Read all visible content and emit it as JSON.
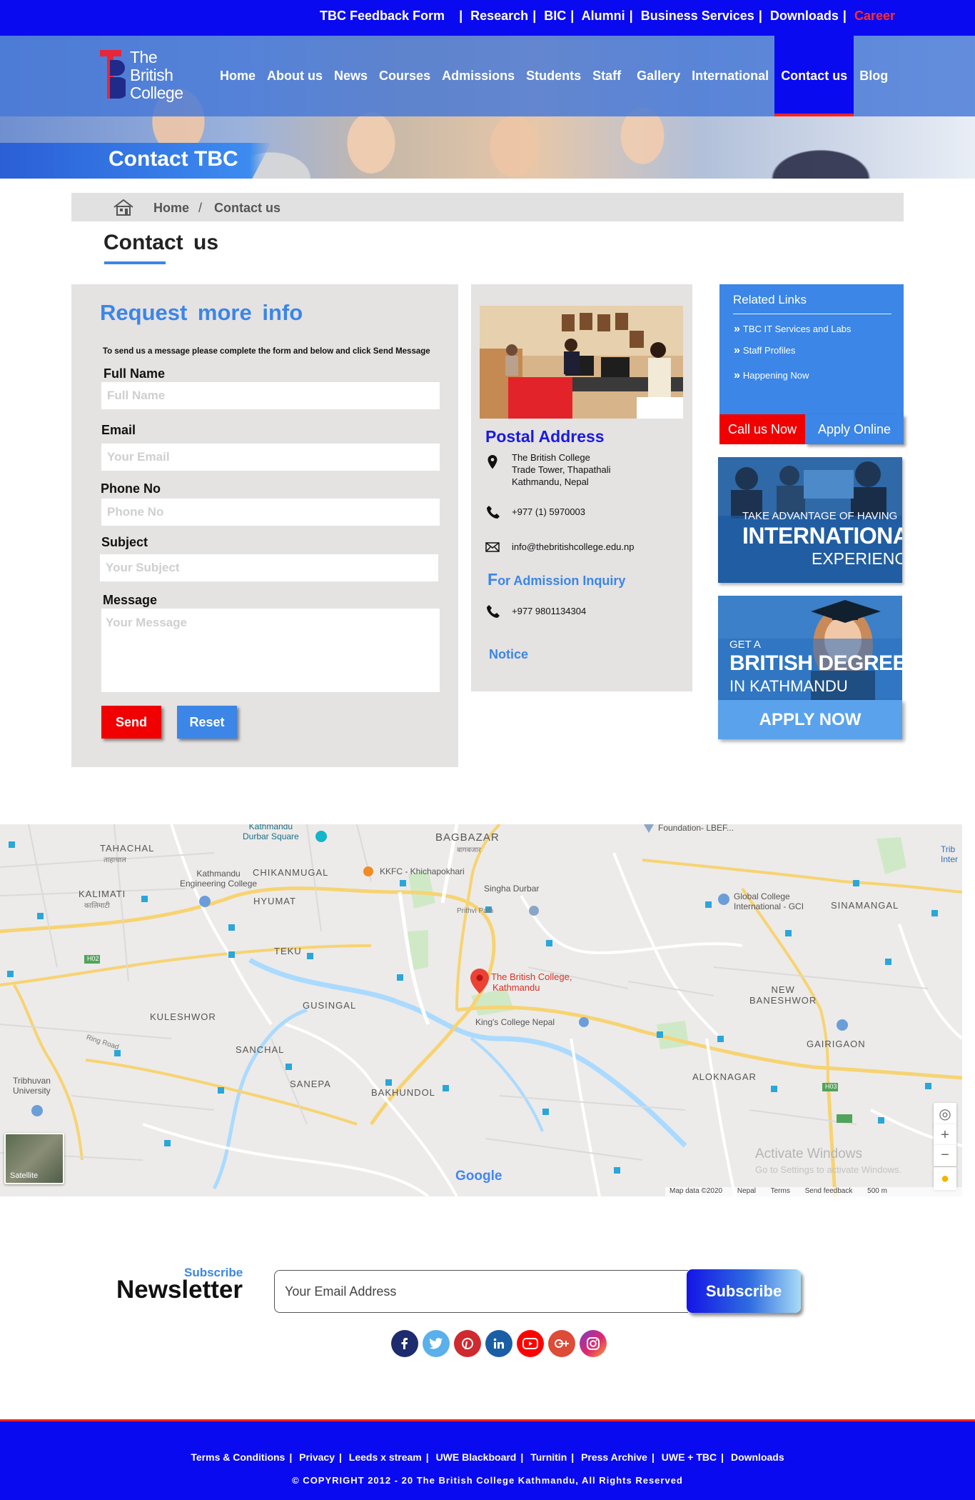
{
  "topbar": {
    "feedback": "TBC Feedback Form",
    "links": [
      "Research",
      "BIC",
      "Alumni",
      "Business Services",
      "Downloads"
    ],
    "career": "Career"
  },
  "logo": {
    "line1": "The",
    "line2": "British",
    "line3": "College"
  },
  "nav": [
    "Home",
    "About us",
    "News",
    "Courses",
    "Admissions",
    "Students",
    "Staff",
    "Gallery",
    "International",
    "Contact us",
    "Blog"
  ],
  "nav_active": "Contact us",
  "hero": {
    "title": "Contact TBC"
  },
  "breadcrumb": {
    "home": "Home",
    "sep": "/",
    "current": "Contact us"
  },
  "page_title": "Contact us",
  "form": {
    "heading": "Request more info",
    "intro": "To send us a message please complete the form and below and click Send Message",
    "fields": {
      "full_name": {
        "label": "Full Name",
        "placeholder": "Full Name"
      },
      "email": {
        "label": "Email",
        "placeholder": "Your Email"
      },
      "phone": {
        "label": "Phone No",
        "placeholder": "Phone No"
      },
      "subject": {
        "label": "Subject",
        "placeholder": "Your Subject"
      },
      "message": {
        "label": "Message",
        "placeholder": "Your Message"
      }
    },
    "send_label": "Send",
    "reset_label": "Reset"
  },
  "address": {
    "title": "Postal Address",
    "lines": [
      "The British College",
      "Trade Tower, Thapathali",
      "Kathmandu, Nepal"
    ],
    "phone": "+977 (1)  5970003",
    "email": "info@thebritishcollege.edu.np",
    "inquiry_first": "F",
    "inquiry_rest": "or Admission Inquiry",
    "inquiry_phone": "+977 9801134304",
    "notice": "Notice"
  },
  "related": {
    "title": "Related Links",
    "links": [
      "TBC IT Services and Labs",
      "Staff Profiles",
      "Happening Now"
    ]
  },
  "cta": {
    "call": "Call us Now",
    "apply_online": "Apply Online",
    "apply_now": "APPLY NOW"
  },
  "promo1": {
    "small": "TAKE ADVANTAGE OF HAVING",
    "big": "INTERNATIONAL",
    "sub": "EXPERIENCE"
  },
  "promo2": {
    "small": "GET A",
    "big": "BRITISH DEGREE",
    "sub": "IN KATHMANDU"
  },
  "map": {
    "pin_label_1": "The British College,",
    "pin_label_2": "Kathmandu",
    "places": {
      "tahachal": "TAHACHAL",
      "tahachal_dev": "ताहाचाल",
      "durbar": "Kathmandu\nDurbar Square",
      "bagbazar": "BAGBAZAR",
      "bagbazar_dev": "बागबजार",
      "foundation": "Foundation- LBEF...",
      "kalimati": "KALIMATI",
      "kalimati_dev": "कालिमाटी",
      "engineering": "Kathmandu\nEngineering College",
      "chikanmugal": "CHIKANMUGAL",
      "kkfc": "KKFC - Khichapokhari",
      "singha": "Singha Durbar",
      "global": "Global College\nInternational - GCI",
      "sinamangal": "SINAMANGAL",
      "hyumat": "HYUMAT",
      "prithvi": "Prithvi Path",
      "teku": "TEKU",
      "kulshwor": "KULESHWOR",
      "gusingal": "GUSINGAL",
      "kings": "King's College Nepal",
      "new_baneshwor": "NEW\nBANESHWOR",
      "gairigaon": "GAIRIGAON",
      "sanchal": "SANCHAL",
      "sanepa": "SANEPA",
      "bakhundol": "BAKHUNDOL",
      "aloknagar": "ALOKNAGAR",
      "tribhuvan": "Tribhuvan\nUniversity",
      "ring_road": "Ring Road",
      "h02": "H02",
      "h03": "H03",
      "trib_intl": "Trib\nInter"
    },
    "satellite": "Satellite",
    "google": "Google",
    "activate_title": "Activate Windows",
    "activate_sub": "Go to Settings to activate Windows.",
    "footer": [
      "Map data ©2020",
      "Nepal",
      "Terms",
      "Send feedback",
      "500 m"
    ]
  },
  "newsletter": {
    "sub": "Subscribe",
    "title": "Newsletter",
    "placeholder": "Your Email Address",
    "button": "Subscribe"
  },
  "socials": [
    "facebook-icon",
    "twitter-icon",
    "pinterest-icon",
    "linkedin-icon",
    "youtube-icon",
    "google-plus-icon",
    "instagram-icon"
  ],
  "footer": {
    "links": [
      "Terms & Conditions",
      "Privacy",
      "Leeds x stream",
      "UWE Blackboard",
      "Turnitin",
      "Press Archive",
      "UWE + TBC",
      "Downloads"
    ],
    "copyright": "© COPYRIGHT 2012 - 20 The British College Kathmandu, All Rights Reserved"
  },
  "colors": {
    "brand_blue": "#0a0af0",
    "accent_blue": "#3b86e6",
    "red": "#f00000",
    "panel_grey": "#e5e2e2"
  }
}
